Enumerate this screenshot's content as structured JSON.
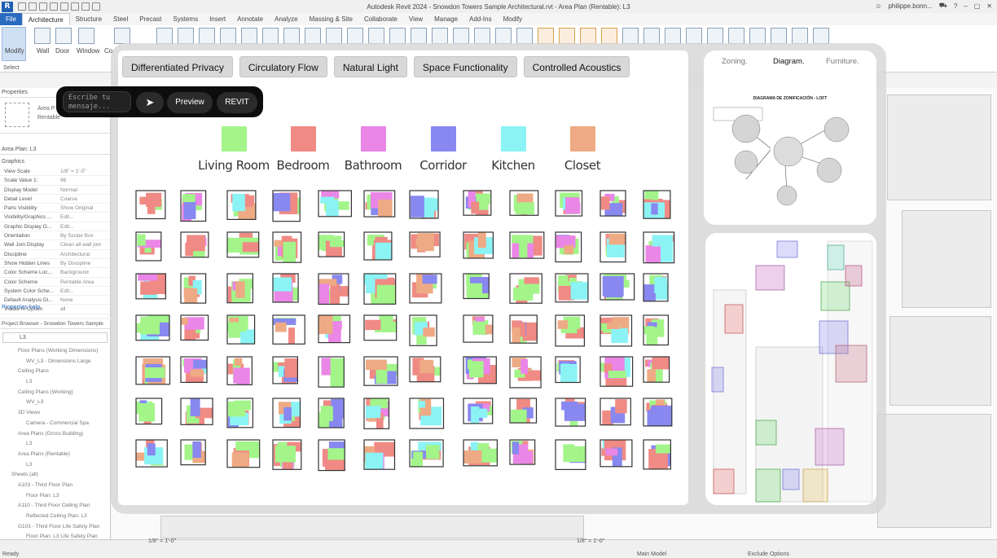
{
  "app": {
    "window_title": "Autodesk Revit 2024 - Snowdon Towers Sample Architectural.rvt - Area Plan (Rentable): L3",
    "user": "philippe.bonn...",
    "menu_tabs": [
      "File",
      "Architecture",
      "Structure",
      "Steel",
      "Precast",
      "Systems",
      "Insert",
      "Annotate",
      "Analyze",
      "Massing & Site",
      "Collaborate",
      "View",
      "Manage",
      "Add-Ins",
      "Modify"
    ],
    "active_tab": "Architecture"
  },
  "ribbon": {
    "modify": "Modify",
    "wall": "Wall",
    "door": "Door",
    "window": "Window",
    "component": "Co",
    "select": "Select"
  },
  "properties": {
    "header": "Properties",
    "type_name": "Area P",
    "type_sub": "Rentable",
    "view_selector": "Area Plan: L3",
    "group": "Graphics",
    "rows": [
      {
        "k": "View Scale",
        "v": "1/8\" = 1'-0\""
      },
      {
        "k": "Scale Value  1:",
        "v": "96"
      },
      {
        "k": "Display Model",
        "v": "Normal"
      },
      {
        "k": "Detail Level",
        "v": "Coarse"
      },
      {
        "k": "Parts Visibility",
        "v": "Show Original"
      },
      {
        "k": "Visibility/Graphics ...",
        "v": "Edit..."
      },
      {
        "k": "Graphic Display O...",
        "v": "Edit..."
      },
      {
        "k": "Orientation",
        "v": "By Scope Box"
      },
      {
        "k": "Wall Join Display",
        "v": "Clean all wall join"
      },
      {
        "k": "Discipline",
        "v": "Architectural"
      },
      {
        "k": "Show Hidden Lines",
        "v": "By Discipline"
      },
      {
        "k": "Color Scheme Loc...",
        "v": "Background"
      },
      {
        "k": "Color Scheme",
        "v": "Rentable Area"
      },
      {
        "k": "System Color Sche...",
        "v": "Edit..."
      },
      {
        "k": "Default Analysis Di...",
        "v": "None"
      },
      {
        "k": "Visible In Option",
        "v": "all"
      }
    ],
    "help": "Properties help"
  },
  "browser": {
    "header": "Project Browser - Snowdon Towers Sample",
    "search": "L3",
    "items": [
      "Floor Plans (Working Dimensions)",
      "WV_L3 - Dimensions Large",
      "Ceiling Plans",
      "L3",
      "Ceiling Plans (Working)",
      "WV_L3",
      "3D Views",
      "Camera - Commercial Spa",
      "Area Plans (Gross Building)",
      "L3",
      "Area Plans (Rentable)",
      "L3",
      "Sheets (all)",
      "A103 - Third Floor Plan",
      "Floor Plan: L3",
      "A110 - Third Floor Ceiling Plan",
      "Reflected Ceiling Plan: L3",
      "G103 - Third Floor Life Safety Plan",
      "Floor Plan: L3 Life Safety Plan"
    ]
  },
  "status": {
    "ready": "Ready",
    "main_model": "Main Model",
    "exclude_options": "Exclude Options",
    "scale_left": "1/8\" = 1'-0\"",
    "scale_right": "1/8\" = 1'-0\""
  },
  "tool": {
    "categories": [
      "Differentiated Privacy",
      "Circulatory Flow",
      "Natural Light",
      "Space Functionality",
      "Controlled Acoustics"
    ],
    "legend": [
      {
        "name": "Living Room",
        "color": "#a3f58a"
      },
      {
        "name": "Bedroom",
        "color": "#f08a84"
      },
      {
        "name": "Bathroom",
        "color": "#ea86e6"
      },
      {
        "name": "Corridor",
        "color": "#8888f0"
      },
      {
        "name": "Kitchen",
        "color": "#8cf3f5"
      },
      {
        "name": "Closet",
        "color": "#eeaa84"
      }
    ],
    "chat": {
      "placeholder": "Escribe tu\nmensaje...",
      "send": "➤",
      "preview": "Preview",
      "revit": "REVIT"
    },
    "right_tabs": [
      "Zoning.",
      "Diagram.",
      "Furniture."
    ],
    "active_right_tab": "Diagram.",
    "diagram_title": "DIAGRAMA DE ZONIFICACIÓN - LOFT"
  }
}
